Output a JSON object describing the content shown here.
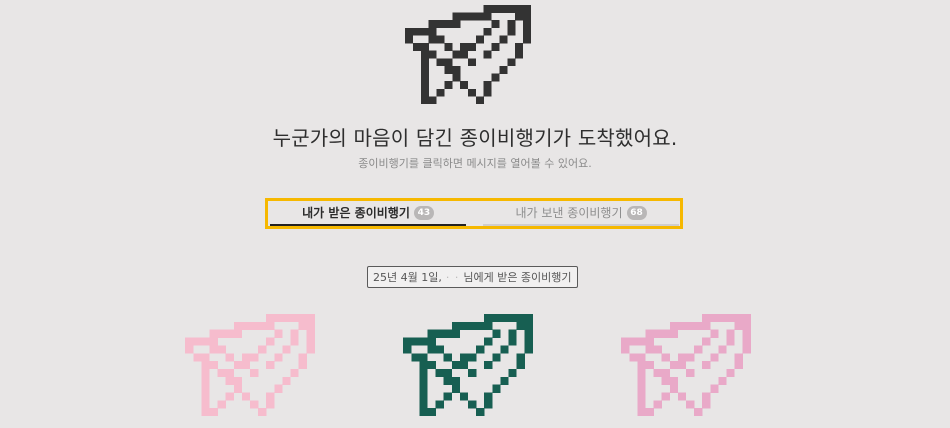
{
  "hero": {
    "icon": "paper-plane-icon",
    "color": "#333333"
  },
  "headline": "누군가의 마음이 담긴 종이비행기가 도착했어요.",
  "subline": "종이비행기를 클릭하면 메시지를 열어볼 수 있어요.",
  "tabs": [
    {
      "label": "내가 받은 종이비행기",
      "count": "43",
      "active": true
    },
    {
      "label": "내가 보낸 종이비행기",
      "count": "68",
      "active": false
    }
  ],
  "date_chip": {
    "prefix": "25년 4월 1일,",
    "masked": "· ·",
    "suffix": "님에게 받은 종이비행기"
  },
  "planes": [
    {
      "icon": "paper-plane-icon",
      "color": "#f6bccd"
    },
    {
      "icon": "paper-plane-icon",
      "color": "#175f52"
    },
    {
      "icon": "paper-plane-icon",
      "color": "#e9a9c8"
    }
  ],
  "colors": {
    "background": "#e8e6e6",
    "highlight_border": "#f6b800"
  }
}
